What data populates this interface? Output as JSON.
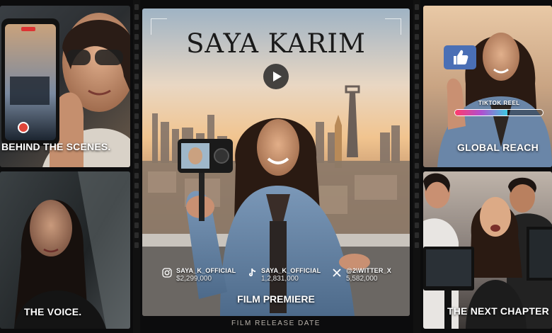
{
  "panels": {
    "behind_the_scenes": {
      "label": "BEHIND THE SCENES."
    },
    "the_voice": {
      "label": "THE VOICE."
    },
    "global_reach": {
      "label": "GLOBAL REACH",
      "tiktok_reel_label": "TIKTOK REEL"
    },
    "the_next_chapter": {
      "label": "THE NEXT CHAPTER"
    }
  },
  "main": {
    "title": "SAYA KARIM",
    "subtitle": "FILM PREMIERE",
    "footer": "FILM RELEASE DATE",
    "socials": [
      {
        "icon": "instagram-icon",
        "handle": "SAYA_K_OFFICIAL",
        "count": "$2,299,000"
      },
      {
        "icon": "tiktok-icon",
        "handle": "SAYA_K_OFFICIAL",
        "count": "1,2,831,000"
      },
      {
        "icon": "x-icon",
        "handle": "@2\\WITTER_X",
        "count": "5,582,000"
      }
    ]
  },
  "colors": {
    "background": "#0c0c0d",
    "label_text": "#ffffff",
    "title_text": "#1a1a1a",
    "like_badge": "#4a6fb5"
  }
}
